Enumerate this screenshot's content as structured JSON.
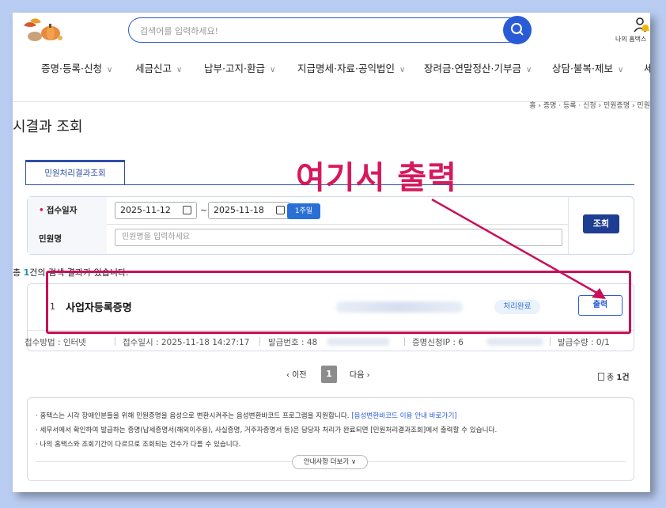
{
  "header": {
    "search_placeholder": "검색어를 입력하세요!",
    "user_label": "나의 홈택스"
  },
  "nav": {
    "items": [
      {
        "label": "증명·등록·신청"
      },
      {
        "label": "세금신고"
      },
      {
        "label": "납부·고지·환급"
      },
      {
        "label": "지급명세·자료·공익법인"
      },
      {
        "label": "장려금·연말정산·기부금"
      },
      {
        "label": "상담·불복·제보"
      },
      {
        "label": "세"
      }
    ],
    "chevron": "∨"
  },
  "breadcrumb": "홈 › 증명 · 등록 · 신청 › 민원증명 › 민원",
  "page_title": "시결과 조회",
  "tab_label": "민원처리결과조회",
  "annotation_text": "여기서 출력",
  "form": {
    "date_label": "접수일자",
    "star": "•",
    "date_from": "2025-11-12",
    "tilde": "~",
    "date_to": "2025-11-18",
    "week_label": "1주일",
    "name_label": "민원명",
    "name_placeholder": "민원명을 입력하세요",
    "search_label": "조회"
  },
  "result": {
    "prefix": "총 ",
    "count": "1",
    "suffix": "건의 검색 결과가 있습니다."
  },
  "row": {
    "number": "1",
    "title": "사업자등록증명",
    "status": "처리완료",
    "print_label": "출력",
    "method": "접수방법 : 인터넷",
    "received": "접수일시 : 2025-11-18 14:27:17",
    "issue_no": "발급번호 : 48",
    "ip": "증명신청IP : 6",
    "qty": "발급수량 : 0/1"
  },
  "pager": {
    "prev": "‹ 이전",
    "current": "1",
    "next": "다음 ›",
    "total_prefix": "총 ",
    "total_count": "1건"
  },
  "info": {
    "line1": "· 홈택스는 시각 장애인분들을 위해 민원증명을 음성으로 변환시켜주는 음성변환바코드 프로그램을 지원합니다.",
    "line1_link": "[음성변환바코드 이용 안내 바로가기]",
    "line2": "· 세무서에서 확인하여 발급하는 증명(납세증명서(해외이주용), 사실증명, 거주자증명서 등)은 담당자 처리가 완료되면 [민원처리결과조회]에서 출력할 수 있습니다.",
    "line3": "· 나의 홈택스와 조회기간이 다르므로 조회되는 건수가 다를 수 있습니다.",
    "more_label": "안내사항 더보기 ∨"
  },
  "colors": {
    "accent": "#2a5bd7",
    "annotation": "#d6195c"
  }
}
